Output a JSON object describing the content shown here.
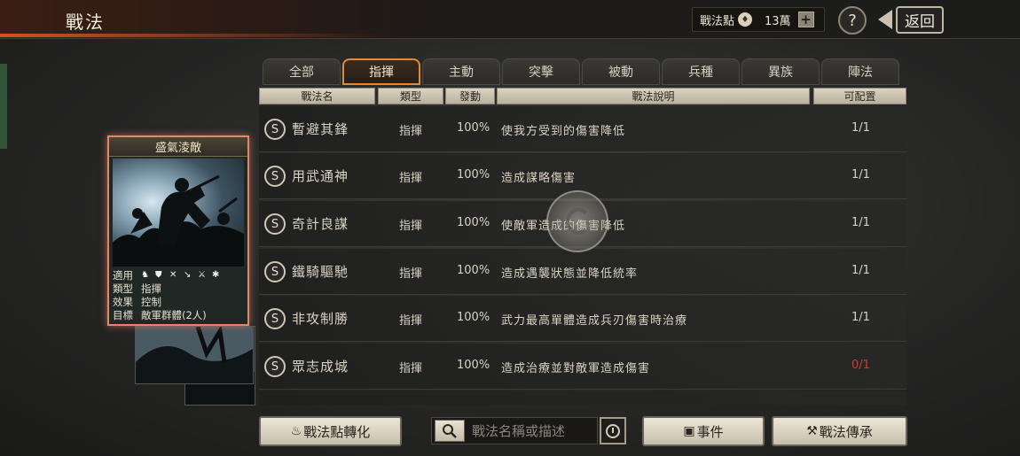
{
  "header": {
    "title": "戰法",
    "points_label": "戰法點",
    "points_value": "13萬",
    "help_label": "?",
    "back_label": "返回"
  },
  "tabs": [
    {
      "label": "全部"
    },
    {
      "label": "指揮",
      "active": true
    },
    {
      "label": "主動"
    },
    {
      "label": "突擊"
    },
    {
      "label": "被動"
    },
    {
      "label": "兵種"
    },
    {
      "label": "異族"
    },
    {
      "label": "陣法"
    }
  ],
  "columns": {
    "name": "戰法名",
    "type": "類型",
    "rate": "發動",
    "desc": "戰法說明",
    "slots": "可配置"
  },
  "rows": [
    {
      "grade": "S",
      "name": "暫避其鋒",
      "type": "指揮",
      "rate": "100%",
      "desc": "使我方受到的傷害降低",
      "slots": "1/1",
      "full": false
    },
    {
      "grade": "S",
      "name": "用武通神",
      "type": "指揮",
      "rate": "100%",
      "desc": "造成謀略傷害",
      "slots": "1/1",
      "full": false
    },
    {
      "grade": "S",
      "name": "奇計良謀",
      "type": "指揮",
      "rate": "100%",
      "desc": "使敵軍造成的傷害降低",
      "slots": "1/1",
      "full": false
    },
    {
      "grade": "S",
      "name": "鐵騎驅馳",
      "type": "指揮",
      "rate": "100%",
      "desc": "造成遇襲狀態並降低統率",
      "slots": "1/1",
      "full": false
    },
    {
      "grade": "S",
      "name": "非攻制勝",
      "type": "指揮",
      "rate": "100%",
      "desc": "武力最高單體造成兵刃傷害時治療",
      "slots": "1/1",
      "full": false
    },
    {
      "grade": "S",
      "name": "眾志成城",
      "type": "指揮",
      "rate": "100%",
      "desc": "造成治療並對敵軍造成傷害",
      "slots": "0/1",
      "full": true
    }
  ],
  "card": {
    "title": "盛氣淩敵",
    "apply_label": "適用",
    "type_label": "類型",
    "type_value": "指揮",
    "effect_label": "效果",
    "effect_value": "控制",
    "target_label": "目標",
    "target_value": "敵軍群體(2人)",
    "unit_icons": [
      "cavalry-icon",
      "shield-icon",
      "bow-icon",
      "spear-icon",
      "siege-icon",
      "wheel-icon"
    ]
  },
  "bottom": {
    "convert_label": "戰法點轉化",
    "search_placeholder": "戰法名稱或描述",
    "event_label": "事件",
    "inherit_label": "戰法傳承"
  },
  "colors": {
    "active_tab": "#e08a3a",
    "slots_full": "#d23a2a",
    "card_border": "#e0886a"
  }
}
